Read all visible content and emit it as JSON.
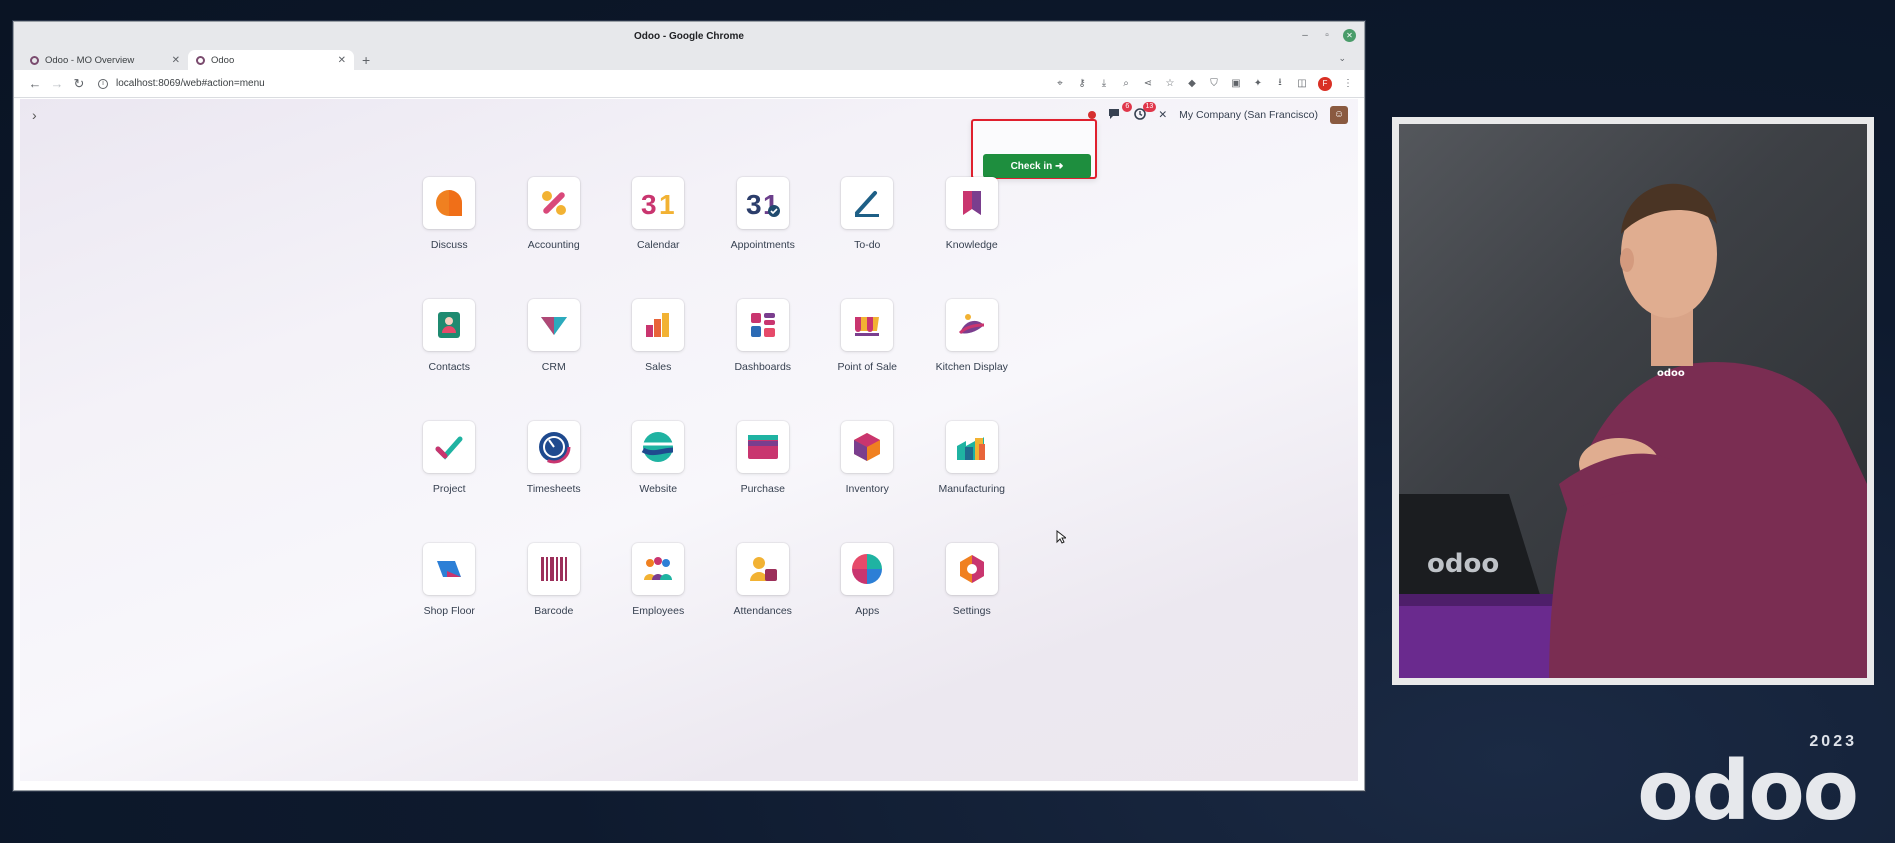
{
  "browser": {
    "window_title": "Odoo - Google Chrome",
    "tabs": [
      {
        "label": "Odoo - MO Overview",
        "active": false
      },
      {
        "label": "Odoo",
        "active": true
      }
    ],
    "url": "localhost:8069/web#action=menu"
  },
  "systray": {
    "messages_badge": "6",
    "activities_badge": "13",
    "company": "My Company (San Francisco)"
  },
  "checkin": {
    "button_label": "Check in",
    "highlight_color": "#e0202e",
    "button_color": "#1e8e3e"
  },
  "apps": [
    {
      "label": "Discuss",
      "icon": "discuss-icon"
    },
    {
      "label": "Accounting",
      "icon": "accounting-icon"
    },
    {
      "label": "Calendar",
      "icon": "calendar-icon"
    },
    {
      "label": "Appointments",
      "icon": "appointments-icon"
    },
    {
      "label": "To-do",
      "icon": "todo-icon"
    },
    {
      "label": "Knowledge",
      "icon": "knowledge-icon"
    },
    {
      "label": "Contacts",
      "icon": "contacts-icon"
    },
    {
      "label": "CRM",
      "icon": "crm-icon"
    },
    {
      "label": "Sales",
      "icon": "sales-icon"
    },
    {
      "label": "Dashboards",
      "icon": "dashboards-icon"
    },
    {
      "label": "Point of Sale",
      "icon": "point-of-sale-icon"
    },
    {
      "label": "Kitchen Display",
      "icon": "kitchen-display-icon"
    },
    {
      "label": "Project",
      "icon": "project-icon"
    },
    {
      "label": "Timesheets",
      "icon": "timesheets-icon"
    },
    {
      "label": "Website",
      "icon": "website-icon"
    },
    {
      "label": "Purchase",
      "icon": "purchase-icon"
    },
    {
      "label": "Inventory",
      "icon": "inventory-icon"
    },
    {
      "label": "Manufacturing",
      "icon": "manufacturing-icon"
    },
    {
      "label": "Shop Floor",
      "icon": "shop-floor-icon"
    },
    {
      "label": "Barcode",
      "icon": "barcode-icon"
    },
    {
      "label": "Employees",
      "icon": "employees-icon"
    },
    {
      "label": "Attendances",
      "icon": "attendances-icon"
    },
    {
      "label": "Apps",
      "icon": "apps-icon"
    },
    {
      "label": "Settings",
      "icon": "settings-icon"
    }
  ],
  "branding": {
    "year": "2023",
    "logo": "odoo"
  }
}
